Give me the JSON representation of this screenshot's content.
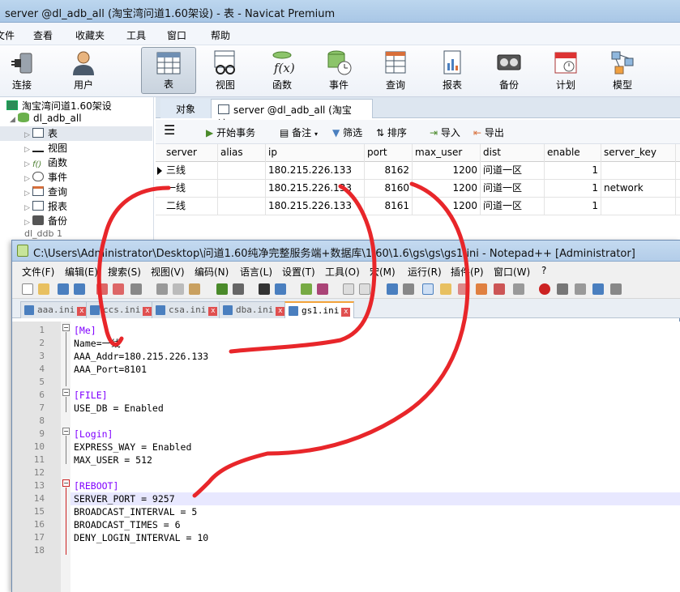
{
  "navicat": {
    "title": "server @dl_adb_all (淘宝湾问道1.60架设) - 表 - Navicat Premium",
    "menu": [
      "文件",
      "查看",
      "收藏夹",
      "工具",
      "窗口",
      "帮助"
    ],
    "toolbar": [
      "连接",
      "用户",
      "表",
      "视图",
      "函数",
      "事件",
      "查询",
      "报表",
      "备份",
      "计划",
      "模型"
    ],
    "tree": {
      "connection": "淘宝湾问道1.60架设",
      "database": "dl_adb_all",
      "items": [
        "表",
        "视图",
        "函数",
        "事件",
        "查询",
        "报表",
        "备份"
      ],
      "next_database": "dl_ddb 1"
    },
    "tabs": {
      "objects": "对象",
      "table": "server @dl_adb_all (淘宝湾..."
    },
    "subtoolbar": {
      "transaction": "开始事务",
      "note": "备注",
      "filter": "筛选",
      "sort": "排序",
      "import": "导入",
      "export": "导出"
    },
    "grid": {
      "columns": [
        "server",
        "alias",
        "ip",
        "port",
        "max_user",
        "dist",
        "enable",
        "server_key"
      ],
      "rows": [
        {
          "server": "三线",
          "alias": "",
          "ip": "180.215.226.133",
          "port": "8162",
          "max_user": "1200",
          "dist": "问道一区",
          "enable": "1",
          "server_key": ""
        },
        {
          "server": "一线",
          "alias": "",
          "ip": "180.215.226.133",
          "port": "8160",
          "max_user": "1200",
          "dist": "问道一区",
          "enable": "1",
          "server_key": "network"
        },
        {
          "server": "二线",
          "alias": "",
          "ip": "180.215.226.133",
          "port": "8161",
          "max_user": "1200",
          "dist": "问道一区",
          "enable": "1",
          "server_key": ""
        }
      ]
    }
  },
  "notepad": {
    "title": "C:\\Users\\Administrator\\Desktop\\问道1.60纯净完整服务端+数据库\\1.60\\1.6\\gs\\gs\\gs1.ini - Notepad++ [Administrator]",
    "menu": [
      "文件(F)",
      "编辑(E)",
      "搜索(S)",
      "视图(V)",
      "编码(N)",
      "语言(L)",
      "设置(T)",
      "工具(O)",
      "宏(M)",
      "运行(R)",
      "插件(P)",
      "窗口(W)",
      "?"
    ],
    "tabs": [
      "aaa.ini",
      "ccs.ini",
      "csa.ini",
      "dba.ini",
      "gs1.ini"
    ],
    "active_tab": "gs1.ini",
    "lines": [
      {
        "n": "1",
        "parts": [
          {
            "t": "[Me]",
            "c": "sec"
          }
        ]
      },
      {
        "n": "2",
        "parts": [
          {
            "t": "Name=一线",
            "c": "key"
          }
        ]
      },
      {
        "n": "3",
        "parts": [
          {
            "t": "AAA_Addr=180.215.226.133",
            "c": "key"
          }
        ]
      },
      {
        "n": "4",
        "parts": [
          {
            "t": "AAA_Port=8101",
            "c": "key"
          }
        ]
      },
      {
        "n": "5",
        "parts": []
      },
      {
        "n": "6",
        "parts": [
          {
            "t": "[FILE]",
            "c": "sec"
          }
        ]
      },
      {
        "n": "7",
        "parts": [
          {
            "t": "USE_DB = Enabled",
            "c": "key"
          }
        ]
      },
      {
        "n": "8",
        "parts": []
      },
      {
        "n": "9",
        "parts": [
          {
            "t": "[Login]",
            "c": "sec"
          }
        ]
      },
      {
        "n": "10",
        "parts": [
          {
            "t": "EXPRESS_WAY = Enabled",
            "c": "key"
          }
        ]
      },
      {
        "n": "11",
        "parts": [
          {
            "t": "MAX_USER = 512",
            "c": "key"
          }
        ]
      },
      {
        "n": "12",
        "parts": []
      },
      {
        "n": "13",
        "parts": [
          {
            "t": "[REBOOT]",
            "c": "sec"
          }
        ]
      },
      {
        "n": "14",
        "parts": [
          {
            "t": "SERVER_PORT = 9257",
            "c": "key"
          }
        ]
      },
      {
        "n": "15",
        "parts": [
          {
            "t": "BROADCAST_INTERVAL = 5",
            "c": "key"
          }
        ]
      },
      {
        "n": "16",
        "parts": [
          {
            "t": "BROADCAST_TIMES = 6",
            "c": "key"
          }
        ]
      },
      {
        "n": "17",
        "parts": [
          {
            "t": "DENY_LOGIN_INTERVAL = 10",
            "c": "key"
          }
        ]
      },
      {
        "n": "18",
        "parts": []
      }
    ],
    "current_line": "14"
  },
  "colors": {
    "section": "#8000ff",
    "annotation": "#e8262a",
    "current_line": "#e8e8ff"
  }
}
